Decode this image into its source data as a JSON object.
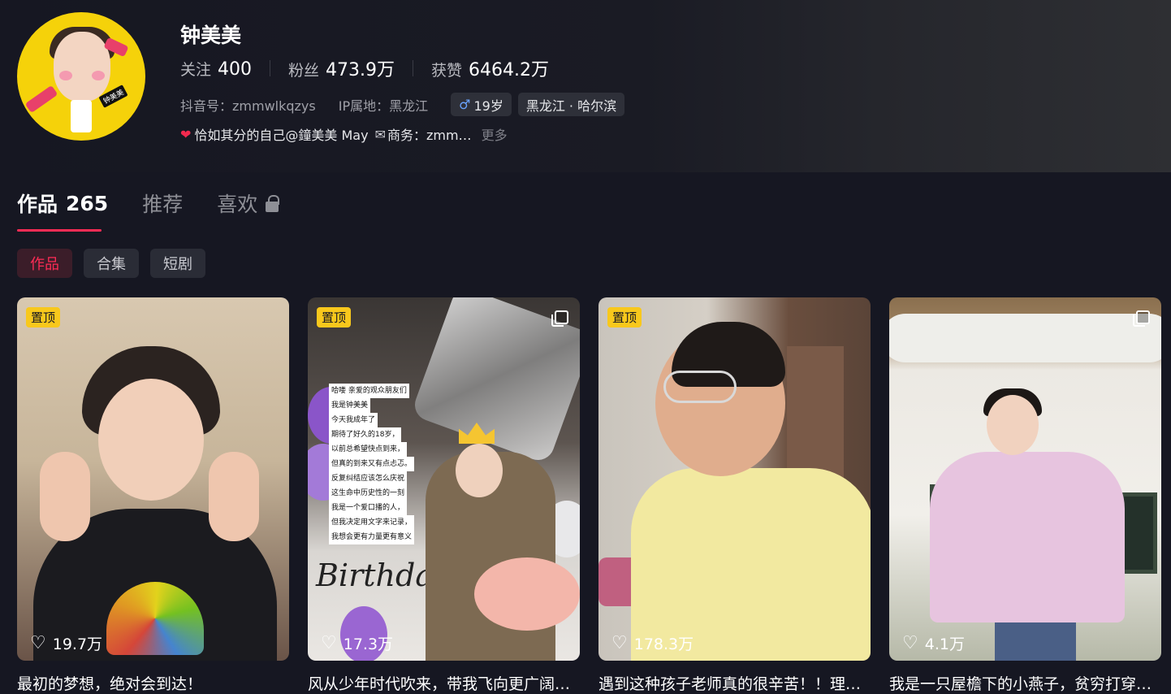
{
  "profile": {
    "name": "钟美美",
    "stats": [
      {
        "label": "关注",
        "value": "400"
      },
      {
        "label": "粉丝",
        "value": "473.9万"
      },
      {
        "label": "获赞",
        "value": "6464.2万"
      }
    ],
    "douyin_id": "抖音号：zmmwlkqzys",
    "ip_location": "IP属地：黑龙江",
    "gender_symbol": "♂",
    "age": "19岁",
    "region": "黑龙江 · 哈尔滨",
    "bio_heart": "❤",
    "bio": "恰如其分的自己@鐘美美 May",
    "business_icon": "✉",
    "business": "商务：zmm…",
    "more": "更多",
    "avatar_tag": "钟美美"
  },
  "tabs": [
    {
      "label": "作品",
      "count": "265"
    },
    {
      "label": "推荐"
    },
    {
      "label": "喜欢"
    }
  ],
  "chips": [
    "作品",
    "合集",
    "短剧"
  ],
  "videos": [
    {
      "pinned": "置顶",
      "likes": "19.7万",
      "caption": "最初的梦想，绝对会到达！"
    },
    {
      "pinned": "置顶",
      "likes": "17.3万",
      "caption": "风从少年时代吹来，带我飞向更广阔…",
      "overlay_lines": [
        "哈喽 亲爱的观众朋友们",
        "我是钟美美",
        "今天我成年了",
        "期待了好久的18岁，",
        "以前总希望快点到来，",
        "但真的到来又有点忐忑。",
        "反复纠结应该怎么庆祝",
        "这生命中历史性的一刻",
        "我是一个爱口播的人，",
        "但我决定用文字来记录，",
        "我想会更有力量更有意义"
      ],
      "script": "Birthda"
    },
    {
      "pinned": "置顶",
      "likes": "178.3万",
      "caption": "遇到这种孩子老师真的很辛苦！！理…"
    },
    {
      "likes": "4.1万",
      "caption": "我是一只屋檐下的小燕子，贫穷打穿…"
    }
  ],
  "icons": {
    "like": "heart-outline-icon",
    "multi": "multi-image-icon",
    "lock": "lock-icon"
  },
  "colors": {
    "accent": "#fe2c55",
    "pin": "#f8c81c",
    "bg": "#161722"
  }
}
